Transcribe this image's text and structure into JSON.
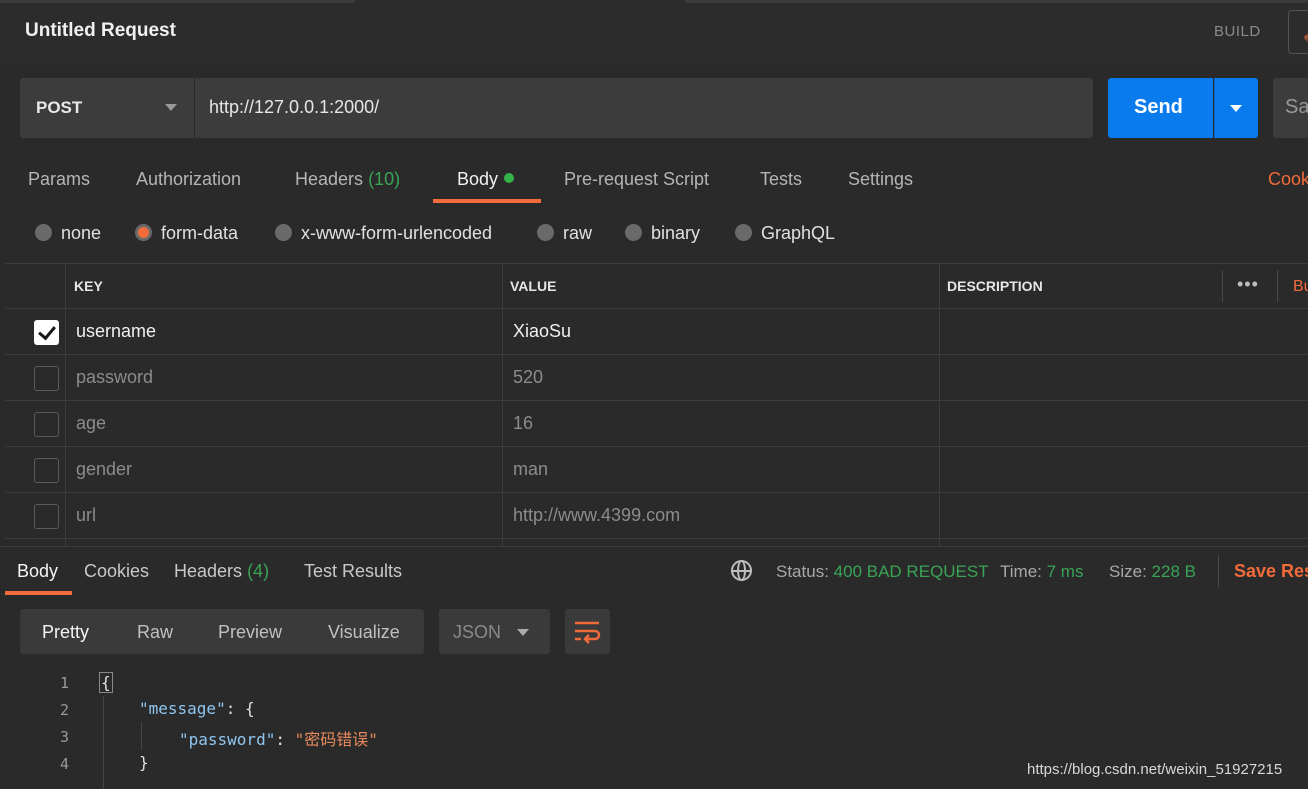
{
  "title_bar": {
    "title": "Untitled Request",
    "build_label": "BUILD"
  },
  "request": {
    "method": "POST",
    "url": "http://127.0.0.1:2000/",
    "send_label": "Send",
    "save_label": "Sa"
  },
  "request_tabs": [
    {
      "label": "Params"
    },
    {
      "label": "Authorization"
    },
    {
      "label": "Headers",
      "count": "(10)"
    },
    {
      "label": "Body",
      "active": true
    },
    {
      "label": "Pre-request Script"
    },
    {
      "label": "Tests"
    },
    {
      "label": "Settings"
    }
  ],
  "cookies_link": "Cook",
  "body_types": [
    {
      "label": "none"
    },
    {
      "label": "form-data",
      "selected": true
    },
    {
      "label": "x-www-form-urlencoded"
    },
    {
      "label": "raw"
    },
    {
      "label": "binary"
    },
    {
      "label": "GraphQL"
    }
  ],
  "params_table": {
    "headers": {
      "key": "KEY",
      "value": "VALUE",
      "description": "DESCRIPTION",
      "more": "•••",
      "bulk": "Bu"
    },
    "rows": [
      {
        "checked": true,
        "key": "username",
        "value": "XiaoSu"
      },
      {
        "checked": false,
        "key": "password",
        "value": "520"
      },
      {
        "checked": false,
        "key": "age",
        "value": "16"
      },
      {
        "checked": false,
        "key": "gender",
        "value": "man"
      },
      {
        "checked": false,
        "key": "url",
        "value": "http://www.4399.com"
      }
    ]
  },
  "response": {
    "tabs": [
      {
        "label": "Body",
        "active": true
      },
      {
        "label": "Cookies"
      },
      {
        "label": "Headers",
        "count": "(4)"
      },
      {
        "label": "Test Results"
      }
    ],
    "status_label": "Status:",
    "status_value": "400 BAD REQUEST",
    "time_label": "Time:",
    "time_value": "7 ms",
    "size_label": "Size:",
    "size_value": "228 B",
    "save_label": "Save Res"
  },
  "format_toolbar": {
    "tabs": [
      {
        "label": "Pretty",
        "active": true
      },
      {
        "label": "Raw"
      },
      {
        "label": "Preview"
      },
      {
        "label": "Visualize"
      }
    ],
    "language": "JSON"
  },
  "code": {
    "line_numbers": [
      "1",
      "2",
      "3",
      "4"
    ],
    "open_brace": "{",
    "message_key": "\"message\"",
    "colon_brace": ": {",
    "password_key": "\"password\"",
    "colon": ": ",
    "password_value": "\"密码错误\"",
    "close_brace": "}"
  },
  "watermark": "https://blog.csdn.net/weixin_51927215",
  "colors": {
    "accent": "#f26b3a",
    "send": "#097bed",
    "success": "#3aa456",
    "background": "#2a2a2a"
  }
}
